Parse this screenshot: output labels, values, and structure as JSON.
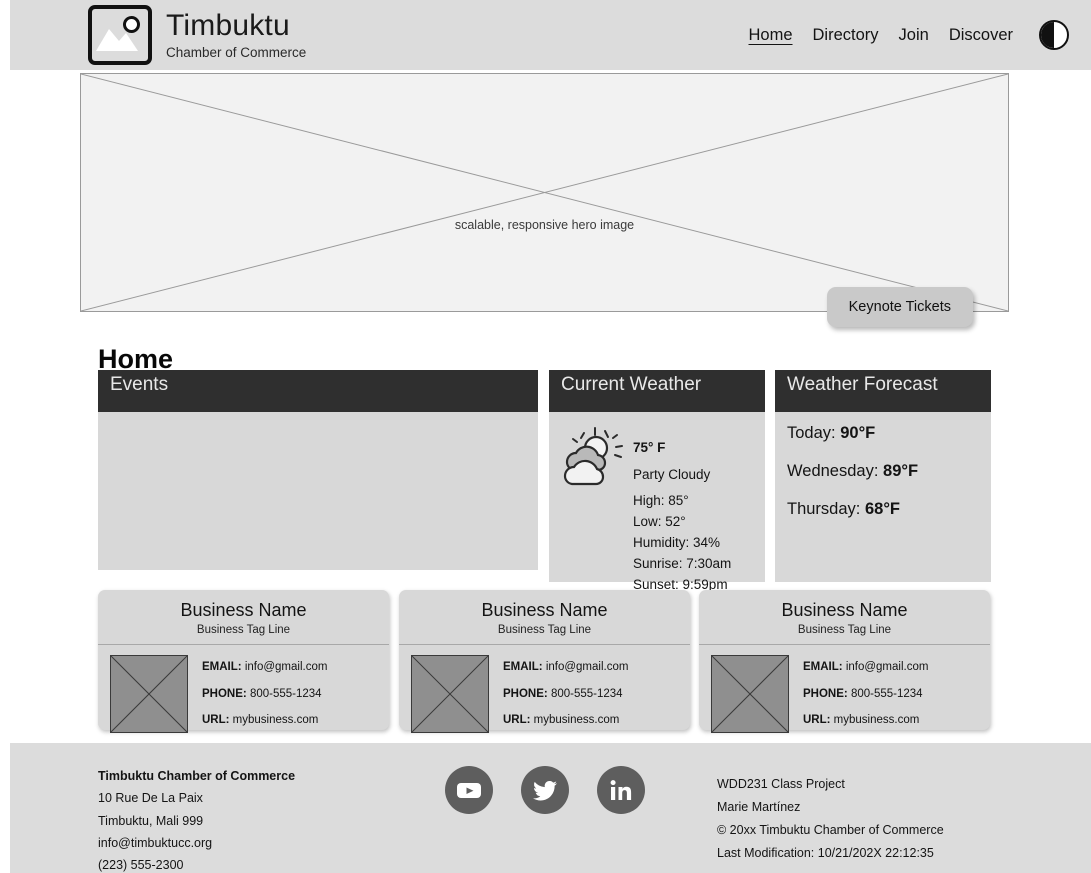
{
  "header": {
    "logo_icon": "image-placeholder-icon",
    "brand_title": "Timbuktu",
    "brand_subtitle": "Chamber of Commerce",
    "nav": [
      {
        "label": "Home",
        "active": true
      },
      {
        "label": "Directory",
        "active": false
      },
      {
        "label": "Join",
        "active": false
      },
      {
        "label": "Discover",
        "active": false
      }
    ],
    "mode_toggle_icon": "dark-mode-contrast-icon"
  },
  "hero": {
    "caption": "scalable, responsive hero image",
    "cta_label": "Keynote Tickets"
  },
  "main": {
    "page_title": "Home",
    "events": {
      "title": "Events",
      "body": ""
    },
    "current_weather": {
      "title": "Current Weather",
      "icon": "sun-behind-cloud-icon",
      "temperature": "75° F",
      "condition": "Party Cloudy",
      "high": "High: 85°",
      "low": "Low: 52°",
      "humidity": "Humidity: 34%",
      "sunrise": "Sunrise: 7:30am",
      "sunset": "Sunset: 9:59pm"
    },
    "forecast": {
      "title": "Weather Forecast",
      "rows": [
        {
          "day": "Today:",
          "temp": "90°F"
        },
        {
          "day": "Wednesday:",
          "temp": "89°F"
        },
        {
          "day": "Thursday:",
          "temp": "68°F"
        }
      ]
    },
    "businesses": [
      {
        "name": "Business Name",
        "tagline": "Business Tag Line",
        "email_label": "EMAIL:",
        "email": "info@gmail.com",
        "phone_label": "PHONE:",
        "phone": "800-555-1234",
        "url_label": "URL:",
        "url": "mybusiness.com",
        "thumb_icon": "image-placeholder-icon"
      },
      {
        "name": "Business Name",
        "tagline": "Business Tag Line",
        "email_label": "EMAIL:",
        "email": "info@gmail.com",
        "phone_label": "PHONE:",
        "phone": "800-555-1234",
        "url_label": "URL:",
        "url": "mybusiness.com",
        "thumb_icon": "image-placeholder-icon"
      },
      {
        "name": "Business Name",
        "tagline": "Business Tag Line",
        "email_label": "EMAIL:",
        "email": "info@gmail.com",
        "phone_label": "PHONE:",
        "phone": "800-555-1234",
        "url_label": "URL:",
        "url": "mybusiness.com",
        "thumb_icon": "image-placeholder-icon"
      }
    ]
  },
  "footer": {
    "org_name": "Timbuktu Chamber of Commerce",
    "address_line1": "10 Rue De La Paix",
    "address_line2": "Timbuktu, Mali 999",
    "email": "info@timbuktucc.org",
    "phone": "(223) 555-2300",
    "social": [
      {
        "name": "youtube-icon"
      },
      {
        "name": "twitter-icon"
      },
      {
        "name": "linkedin-icon"
      }
    ],
    "project": "WDD231 Class Project",
    "author": "Marie Martínez",
    "copyright": "© 20xx Timbuktu Chamber of Commerce",
    "last_modification": "Last Modification: 10/21/202X 22:12:35"
  },
  "colors": {
    "header_bg": "#dcdcdc",
    "card_head_bg": "#2f2f2f",
    "card_body_bg": "#d8d8d8",
    "social_circle": "#5e5e5e",
    "hero_bg": "#f2f2f2"
  }
}
